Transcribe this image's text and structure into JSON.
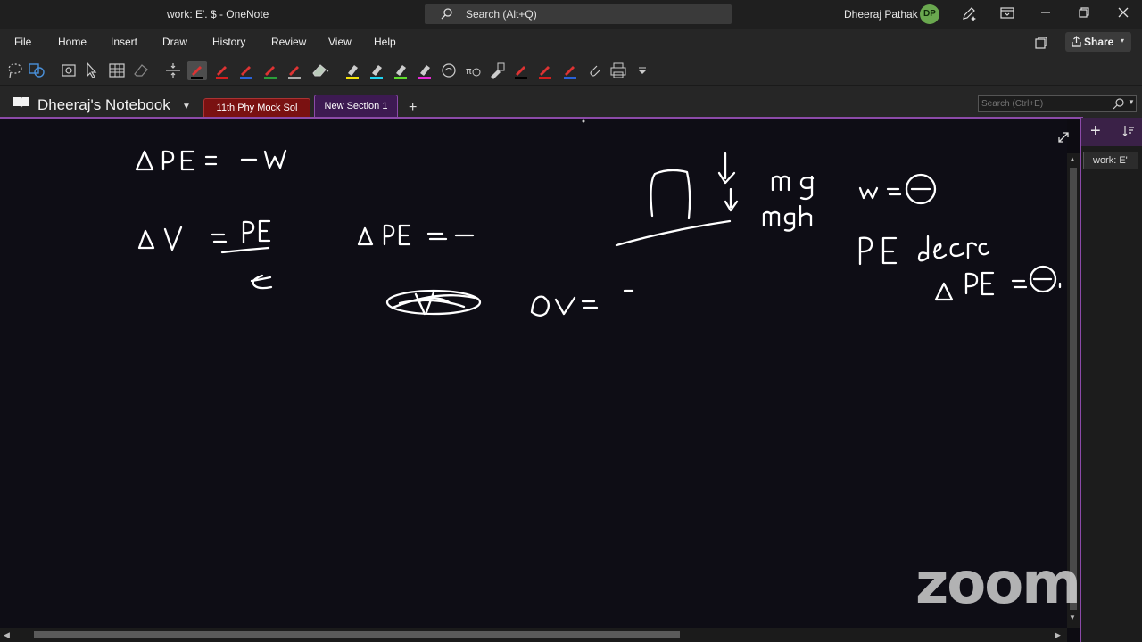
{
  "window": {
    "title": "work: E'. $  -  OneNote",
    "search_label": "Search (Alt+Q)",
    "user_name": "Dheeraj Pathak",
    "user_initials": "DP"
  },
  "menu": [
    "File",
    "Home",
    "Insert",
    "Draw",
    "History",
    "Review",
    "View",
    "Help"
  ],
  "share_label": "Share",
  "notebook": {
    "title": "Dheeraj's Notebook",
    "sections": [
      "11th Phy Mock Sol",
      "New Section 1"
    ],
    "active_section": "New Section 1",
    "page_search_placeholder": "Search (Ctrl+E)"
  },
  "pages": {
    "items": [
      "work: E'"
    ]
  },
  "ink_text": [
    "ΔPE = −W",
    "ΔV = PE/q",
    "ΔPE = −−",
    "Δv = −",
    "mg",
    "mgh",
    "w = (−)",
    "PE decr",
    "ΔPE = (−)"
  ],
  "watermark": "zoom",
  "colors": {
    "accent": "#8b4aa8",
    "section_tab_1": "#7a1111",
    "canvas": "#0e0d15"
  }
}
